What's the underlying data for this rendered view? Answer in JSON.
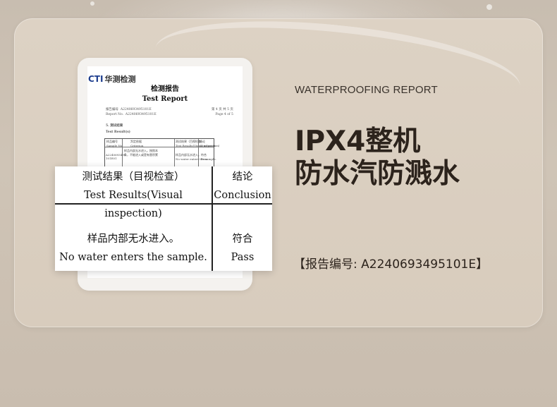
{
  "doc": {
    "logo_en": "CTI",
    "logo_cn": "华测检测",
    "title_cn": "检测报告",
    "title_en": "Test Report",
    "meta_left": "报告编号  A2240693495101E\nReport No.  A2240693495101E",
    "meta_right": "第 4 页 共 5 页\nPage 4 of 5",
    "section": "5.  测试结果",
    "sub": "Test Result(s)",
    "mini": {
      "h1": "样品编号\nSample No.",
      "h2": "判定依据\nCriterion",
      "h3": "测试结果（目视检查）\nTest Results(Visual inspection)",
      "h4": "结论\nConclusion",
      "c1": "A2240693495\n101E01",
      "c2": "样品内部无水进入。按照本\n条，不能进入或是有害积累",
      "c3": "样品内部无水进入。\nNo water enters the sample.",
      "c4": "符合\nPass"
    }
  },
  "zoom": {
    "h_results_cn": "测试结果（目视检查）",
    "h_results_en": "Test Results(Visual inspection)",
    "h_conclusion_cn": "结论",
    "h_conclusion_en": "Conclusion",
    "r_results_cn": "样品内部无水进入。",
    "r_results_en": "No water enters the sample.",
    "r_conclusion_cn": "符合",
    "r_conclusion_en": "Pass"
  },
  "caption": "WATERPROOFING REPORT",
  "headline_line1": "IPX4整机",
  "headline_line2": "防水汽防溅水",
  "report_no": "【报告编号: A2240693495101E】"
}
